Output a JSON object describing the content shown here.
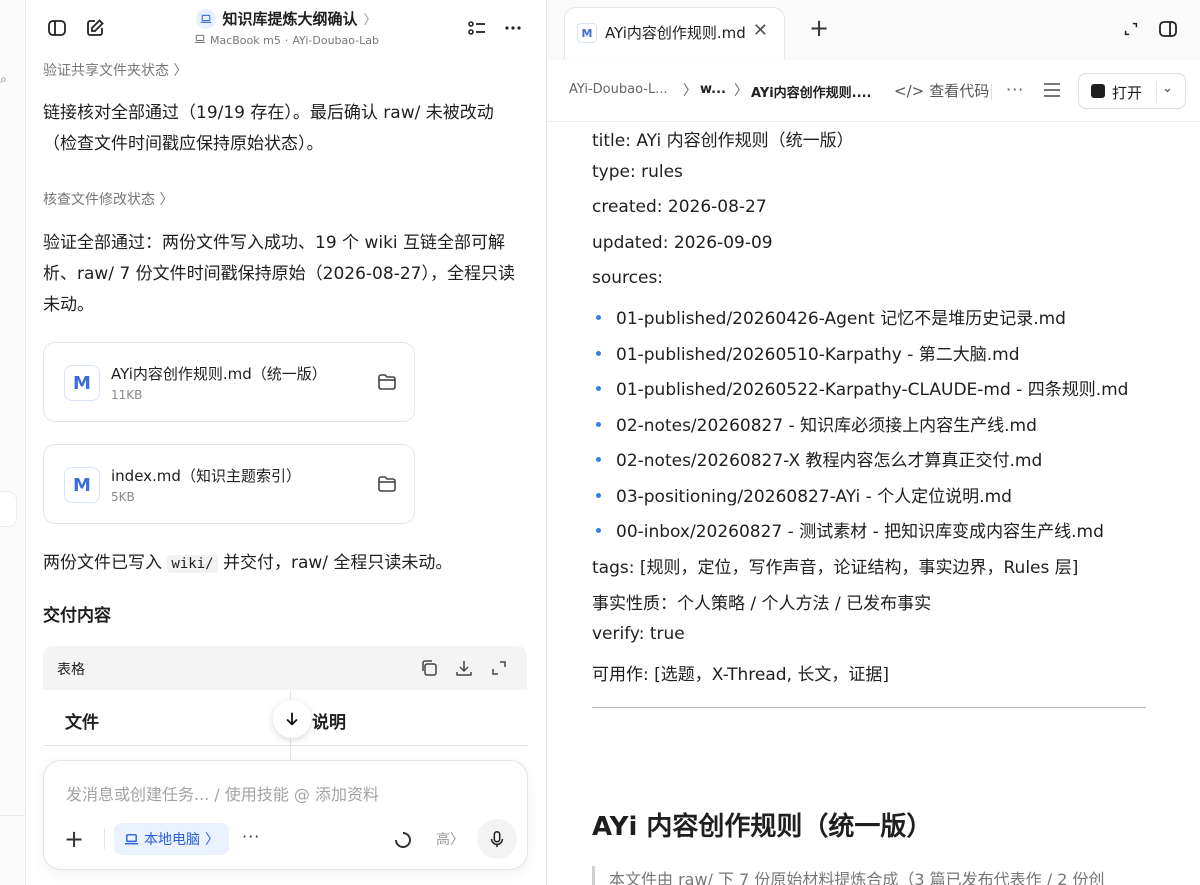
{
  "left": {
    "title": "知识库提炼大纲确认",
    "subtitle_device": "MacBook m5",
    "subtitle_sep": "·",
    "subtitle_project": "AYi-Doubao-Lab",
    "section_verify_shared": "验证共享文件夹状态",
    "para1": "链接核对全部通过（19/19 存在）。最后确认 raw/ 未被改动（检查文件时间戳应保持原始状态）。",
    "section_check_mod": "核查文件修改状态",
    "para2": "验证全部通过：两份文件写入成功、19 个 wiki 互链全部可解析、raw/ 7 份文件时间戳保持原始（2026-08-27），全程只读未动。",
    "files": [
      {
        "icon_letter": "M",
        "name": "AYi内容创作规则.md（统一版）",
        "size": "11KB"
      },
      {
        "icon_letter": "M",
        "name": "index.md（知识主题索引）",
        "size": "5KB"
      }
    ],
    "para3_pre": "两份文件已写入",
    "para3_code": "wiki/",
    "para3_post": "并交付，raw/ 全程只读未动。",
    "delivery_heading": "交付内容",
    "table": {
      "label": "表格",
      "columns": [
        "文件",
        "说明"
      ]
    },
    "composer": {
      "placeholder": "发消息或创建任务... / 使用技能 @ 添加资料",
      "chip_label": "本地电脑",
      "level": "高"
    }
  },
  "right": {
    "tab_title": "AYi内容创作规则.md",
    "tab_icon_letter": "M",
    "breadcrumbs": [
      "AYi-Doubao-L...",
      "w...",
      "AYi内容创作规则...."
    ],
    "view_code": "查看代码",
    "open_button": "打开",
    "frontmatter": {
      "title": "title: AYi 内容创作规则（统一版）",
      "type": "type: rules",
      "created": "created: 2026-08-27",
      "updated": "updated: 2026-09-09",
      "sources_label": "sources:",
      "sources": [
        "01-published/20260426-Agent 记忆不是堆历史记录.md",
        "01-published/20260510-Karpathy - 第二大脑.md",
        "01-published/20260522-Karpathy-CLAUDE-md - 四条规则.md",
        "02-notes/20260827 - 知识库必须接上内容生产线.md",
        "02-notes/20260827-X 教程内容怎么才算真正交付.md",
        "03-positioning/20260827-AYi - 个人定位说明.md",
        "00-inbox/20260827 - 测试素材 - 把知识库变成内容生产线.md"
      ],
      "tags": "tags: [规则，定位，写作声音，论证结构，事实边界，Rules 层]",
      "fact_nature": "事实性质：个人策略 / 个人方法 / 已发布事实",
      "verify": "verify: true",
      "usable": "可用作: [选题，X-Thread, 长文，证据]"
    },
    "doc_heading": "AYi 内容创作规则（统一版）",
    "quote_text": "本文件由 raw/ 下 7 份原始材料提炼合成（3 篇已发布代表作 / 2 份创"
  },
  "colors": {
    "accent": "#3b6ed6",
    "bullet": "#3b7ce0",
    "chip_bg": "#eaf1ff"
  }
}
